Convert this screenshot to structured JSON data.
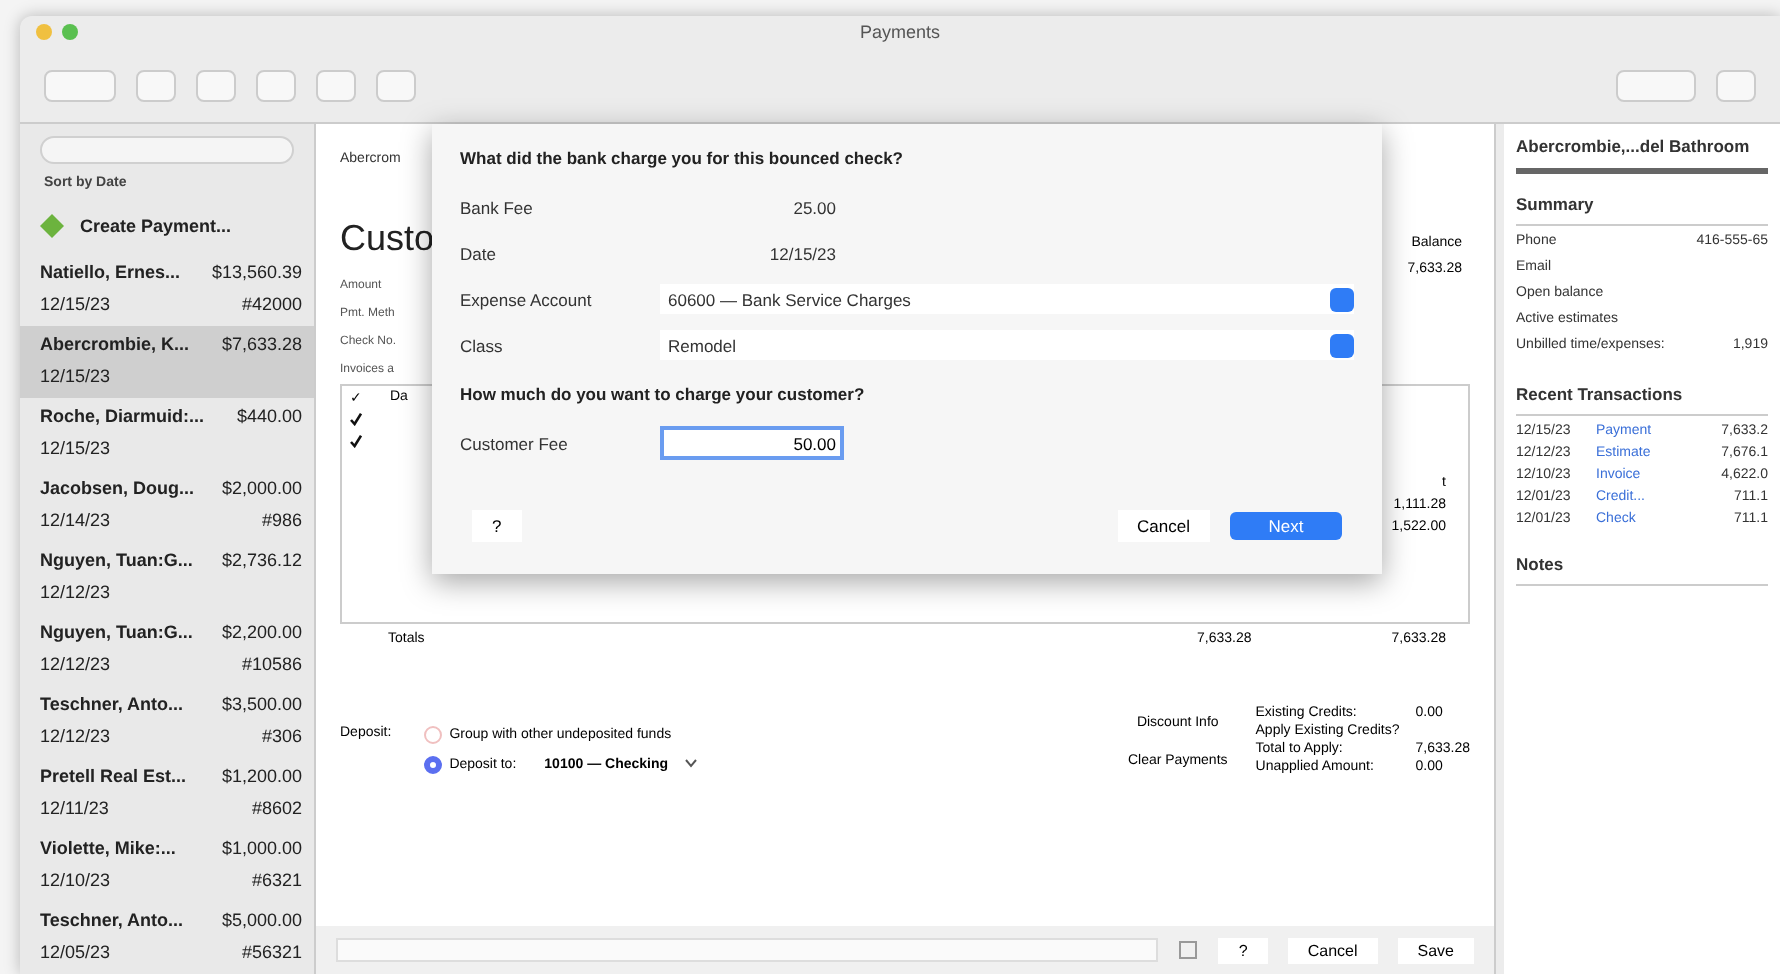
{
  "window": {
    "title": "Payments"
  },
  "sidebar": {
    "sort": "Sort by Date",
    "create": "Create Payment...",
    "items": [
      {
        "name": "Natiello, Ernes...",
        "amount": "$13,560.39",
        "date": "12/15/23",
        "ref": "#42000",
        "selected": false
      },
      {
        "name": "Abercrombie, K...",
        "amount": "$7,633.28",
        "date": "12/15/23",
        "selected": true
      },
      {
        "name": "Roche, Diarmuid:...",
        "amount": "$440.00",
        "date": "12/15/23",
        "selected": false
      },
      {
        "name": "Jacobsen, Doug...",
        "amount": "$2,000.00",
        "date": "12/14/23",
        "ref": "#986",
        "selected": false
      },
      {
        "name": "Nguyen, Tuan:G...",
        "amount": "$2,736.12",
        "date": "12/12/23",
        "selected": false
      },
      {
        "name": "Nguyen, Tuan:G...",
        "amount": "$2,200.00",
        "date": "12/12/23",
        "ref": "#10586",
        "selected": false
      },
      {
        "name": "Teschner, Anto...",
        "amount": "$3,500.00",
        "date": "12/12/23",
        "ref": "#306",
        "selected": false
      },
      {
        "name": "Pretell Real Est...",
        "amount": "$1,200.00",
        "date": "12/11/23",
        "ref": "#8602",
        "selected": false
      },
      {
        "name": "Violette, Mike:...",
        "amount": "$1,000.00",
        "date": "12/10/23",
        "ref": "#6321",
        "selected": false
      },
      {
        "name": "Teschner, Anto...",
        "amount": "$5,000.00",
        "date": "12/05/23",
        "ref": "#56321",
        "selected": false
      }
    ]
  },
  "main": {
    "customer_tab": "Abercrom",
    "heading": "Custo",
    "labels": [
      "Amount",
      "Pmt. Meth",
      "Check No.",
      "Invoices a"
    ],
    "table": {
      "columns": [
        "✓",
        "Da"
      ],
      "rows": [
        {
          "checked": true
        },
        {
          "checked": true
        }
      ],
      "balance_header": "Balance",
      "balance": "7,633.28",
      "column_5": "t",
      "values": [
        "1,111.28",
        "1,522.00"
      ]
    },
    "totals": {
      "label": "Totals",
      "values": [
        "7,633.28",
        "7,633.28"
      ]
    },
    "buttons": [
      "Discount Info",
      "Clear Payments"
    ],
    "credits": [
      {
        "label": "Existing Credits:",
        "value": "0.00"
      },
      {
        "label": "Apply Existing Credits?"
      },
      {
        "label": "Total to Apply:",
        "value": "7,633.28"
      },
      {
        "label": "Unapplied Amount:",
        "value": "0.00"
      }
    ],
    "deposit": {
      "label": "Deposit:",
      "options": [
        {
          "label": "Group with other undeposited funds",
          "selected": false
        },
        {
          "label": "Deposit to:",
          "selected": true
        }
      ],
      "account": "10100 — Checking"
    },
    "footer": {
      "help": "?",
      "cancel": "Cancel",
      "save": "Save"
    }
  },
  "dialog": {
    "question1": "What did the bank charge you for this bounced check?",
    "fields": [
      {
        "kind": "text",
        "label": "Bank Fee",
        "value": "25.00"
      },
      {
        "kind": "text",
        "label": "Date",
        "value": "12/15/23"
      },
      {
        "kind": "select",
        "label": "Expense Account",
        "value": "60600 — Bank Service Charges"
      },
      {
        "kind": "select",
        "label": "Class",
        "value": "Remodel"
      }
    ],
    "question2": "How much do you want to charge your customer?",
    "fee": {
      "label": "Customer Fee",
      "value": "50.00"
    },
    "help": "?",
    "cancel": "Cancel",
    "next": "Next"
  },
  "right_panel": {
    "title": "Abercrombie,...del Bathroom",
    "summary": "Summary",
    "rows": [
      {
        "label": "Phone",
        "value": "416-555-65"
      },
      {
        "label": "Email"
      },
      {
        "label": "Open balance"
      },
      {
        "label": "Active estimates"
      },
      {
        "label": "Unbilled time/expenses:",
        "value": "1,919"
      }
    ],
    "recent": "Recent Transactions",
    "transactions": [
      {
        "date": "12/15/23",
        "type": "Payment",
        "amount": "7,633.2"
      },
      {
        "date": "12/12/23",
        "type": "Estimate",
        "amount": "7,676.1"
      },
      {
        "date": "12/10/23",
        "type": "Invoice",
        "amount": "4,622.0"
      },
      {
        "date": "12/01/23",
        "type": "Credit...",
        "amount": "711.1"
      },
      {
        "date": "12/01/23",
        "type": "Check",
        "amount": "711.1"
      }
    ],
    "notes": "Notes"
  }
}
